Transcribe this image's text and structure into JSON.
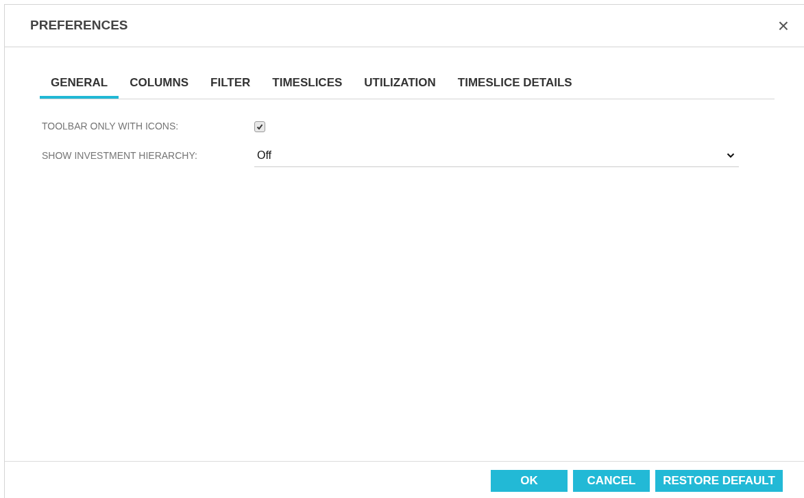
{
  "dialog": {
    "title": "PREFERENCES",
    "close": "×"
  },
  "tabs": [
    {
      "label": "GENERAL",
      "selected": true
    },
    {
      "label": "COLUMNS",
      "selected": false
    },
    {
      "label": "FILTER",
      "selected": false
    },
    {
      "label": "TIMESLICES",
      "selected": false
    },
    {
      "label": "UTILIZATION",
      "selected": false
    },
    {
      "label": "TIMESLICE DETAILS",
      "selected": false
    }
  ],
  "settings": [
    {
      "kind": "checkbox",
      "label": "TOOLBAR ONLY WITH ICONS:",
      "checked": true
    },
    {
      "kind": "select",
      "label": "SHOW INVESTMENT HIERARCHY:",
      "value": "Off"
    }
  ],
  "buttons": [
    "OK",
    "CANCEL",
    "RESTORE DEFAULT"
  ]
}
